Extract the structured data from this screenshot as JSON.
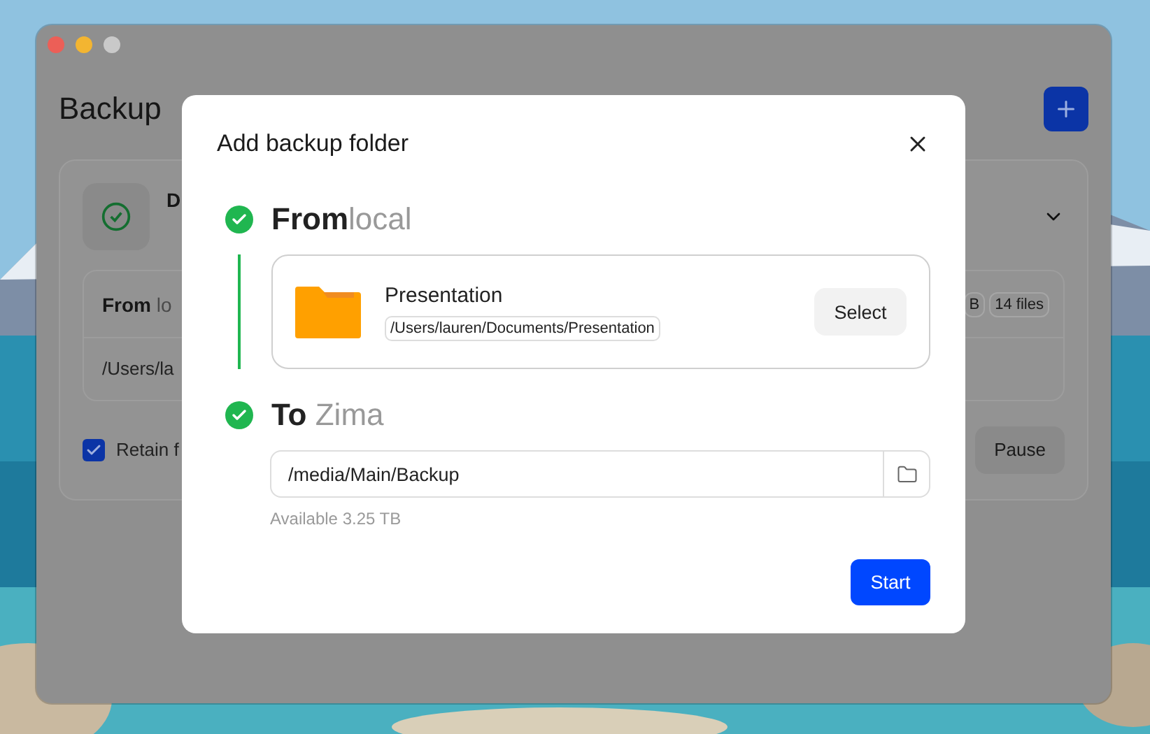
{
  "window": {
    "traffic_lights": [
      {
        "color": "#ec5f57"
      },
      {
        "color": "#f3b531"
      },
      {
        "color": "#c9c9c9"
      }
    ]
  },
  "backup": {
    "title": "Backup",
    "task": {
      "name": "D",
      "source_label": "**From** lo",
      "badges": [
        "B",
        "14 files"
      ],
      "path": "/Users/la",
      "retain": {
        "label": "Retain f",
        "checked": true
      },
      "pause": "Pause"
    }
  },
  "dialog": {
    "title": "Add backup folder",
    "steps": [
      {
        "title": "**From**local",
        "done": true
      },
      {
        "title": "**To** Zima",
        "done": true
      }
    ],
    "source": {
      "name": "Presentation",
      "path": "/Users/lauren/Documents/Presentation",
      "select": "Select"
    },
    "destination": {
      "value": "/media/Main/Backup",
      "available": "Available 3.25 TB"
    },
    "start": "Start"
  }
}
